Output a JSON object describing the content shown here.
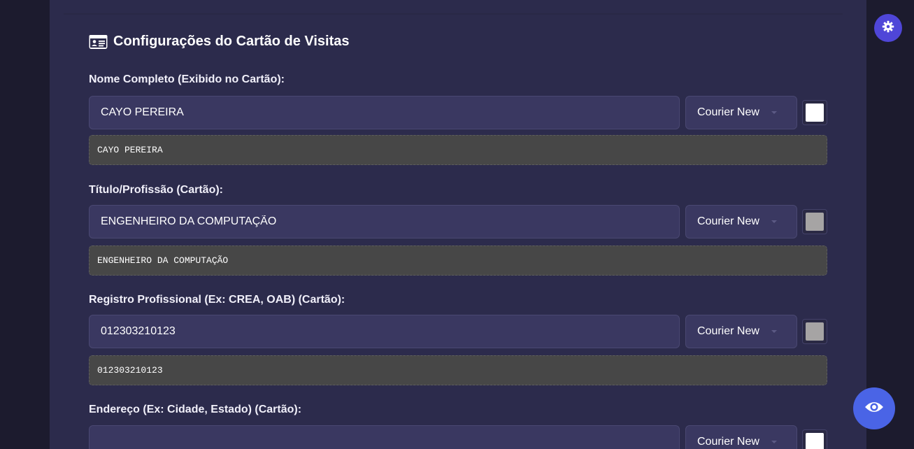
{
  "section": {
    "title": "Configurações do Cartão de Visitas",
    "icon": "id-card-icon"
  },
  "fields": [
    {
      "label": "Nome Completo (Exibido no Cartão):",
      "value": "CAYO PEREIRA",
      "font": "Courier New",
      "color": "#ffffff",
      "preview": "CAYO PEREIRA"
    },
    {
      "label": "Título/Profissão (Cartão):",
      "value": "ENGENHEIRO DA COMPUTAÇÃO",
      "font": "Courier New",
      "color": "#a6a4a4",
      "preview": "ENGENHEIRO DA COMPUTAÇÃO"
    },
    {
      "label": "Registro Profissional (Ex: CREA, OAB) (Cartão):",
      "value": "012303210123",
      "font": "Courier New",
      "color": "#a6a4a4",
      "preview": "012303210123"
    },
    {
      "label": "Endereço (Ex: Cidade, Estado) (Cartão):",
      "value": "",
      "font": "Courier New",
      "color": "#ffffff",
      "preview": ""
    }
  ],
  "floating": {
    "settings_icon": "gear-icon",
    "preview_icon": "eye-icon"
  },
  "colors": {
    "background": "#1c1b2e",
    "panel": "#2c2b4c",
    "input": "#3a3861",
    "preview": "#474747",
    "accent_gear": "#4f46d8",
    "accent_eye": "#4a64e6"
  }
}
